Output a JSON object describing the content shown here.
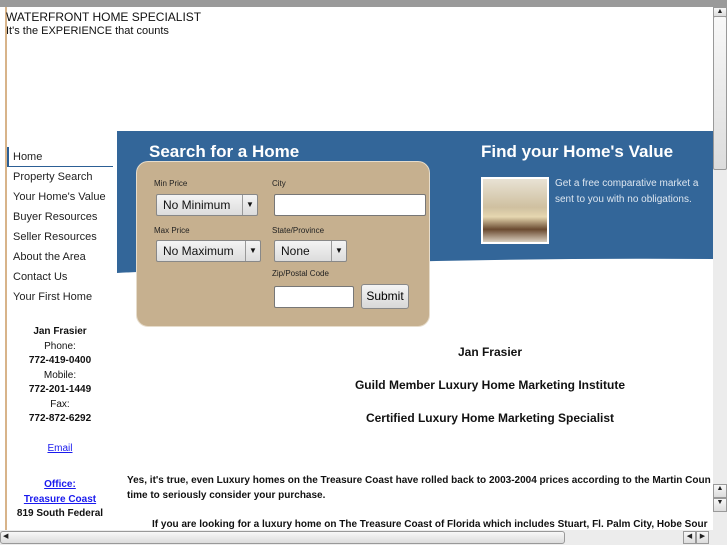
{
  "header": {
    "title": "WATERFRONT HOME SPECIALIST",
    "tagline": "It's the EXPERIENCE that counts"
  },
  "nav": {
    "items": [
      {
        "label": "Home",
        "active": true
      },
      {
        "label": "Property Search"
      },
      {
        "label": "Your Home's Value"
      },
      {
        "label": "Buyer Resources"
      },
      {
        "label": "Seller Resources"
      },
      {
        "label": "About the Area"
      },
      {
        "label": "Contact Us"
      },
      {
        "label": "Your First Home"
      }
    ]
  },
  "contact": {
    "name": "Jan Frasier",
    "phone_label": "Phone:",
    "phone": "772-419-0400",
    "mobile_label": "Mobile:",
    "mobile": "772-201-1449",
    "fax_label": "Fax:",
    "fax": "772-872-6292",
    "email": "Email",
    "office_label": "Office:",
    "office_name": "Treasure Coast",
    "address": "819 South Federal"
  },
  "search": {
    "title": "Search for a Home",
    "min_price_label": "Min Price",
    "min_price": "No Minimum",
    "max_price_label": "Max Price",
    "max_price": "No Maximum",
    "city_label": "City",
    "city_value": "",
    "state_label": "State/Province",
    "state": "None",
    "zip_label": "Zip/Postal Code",
    "zip_value": "",
    "submit": "Submit"
  },
  "value": {
    "title": "Find your Home's Value",
    "line1": "Get a free comparative market a",
    "line2": "sent to you with no obligations."
  },
  "main": {
    "name": "Jan Frasier",
    "line2": "Guild Member Luxury Home Marketing Institute",
    "line3": "Certified Luxury Home Marketing Specialist",
    "para1a": "Yes, it's true, even Luxury homes on the Treasure Coast have rolled back to 2003-2004 prices according to the Martin Coun",
    "para1b": "time to seriously consider your purchase.",
    "para2": "If you are looking for a luxury home on The Treasure Coast of Florida which includes Stuart, Fl. Palm City, Hobe Sour"
  },
  "colors": {
    "banner": "#336699",
    "form": "#c6b08f",
    "link": "#1a1aee"
  }
}
